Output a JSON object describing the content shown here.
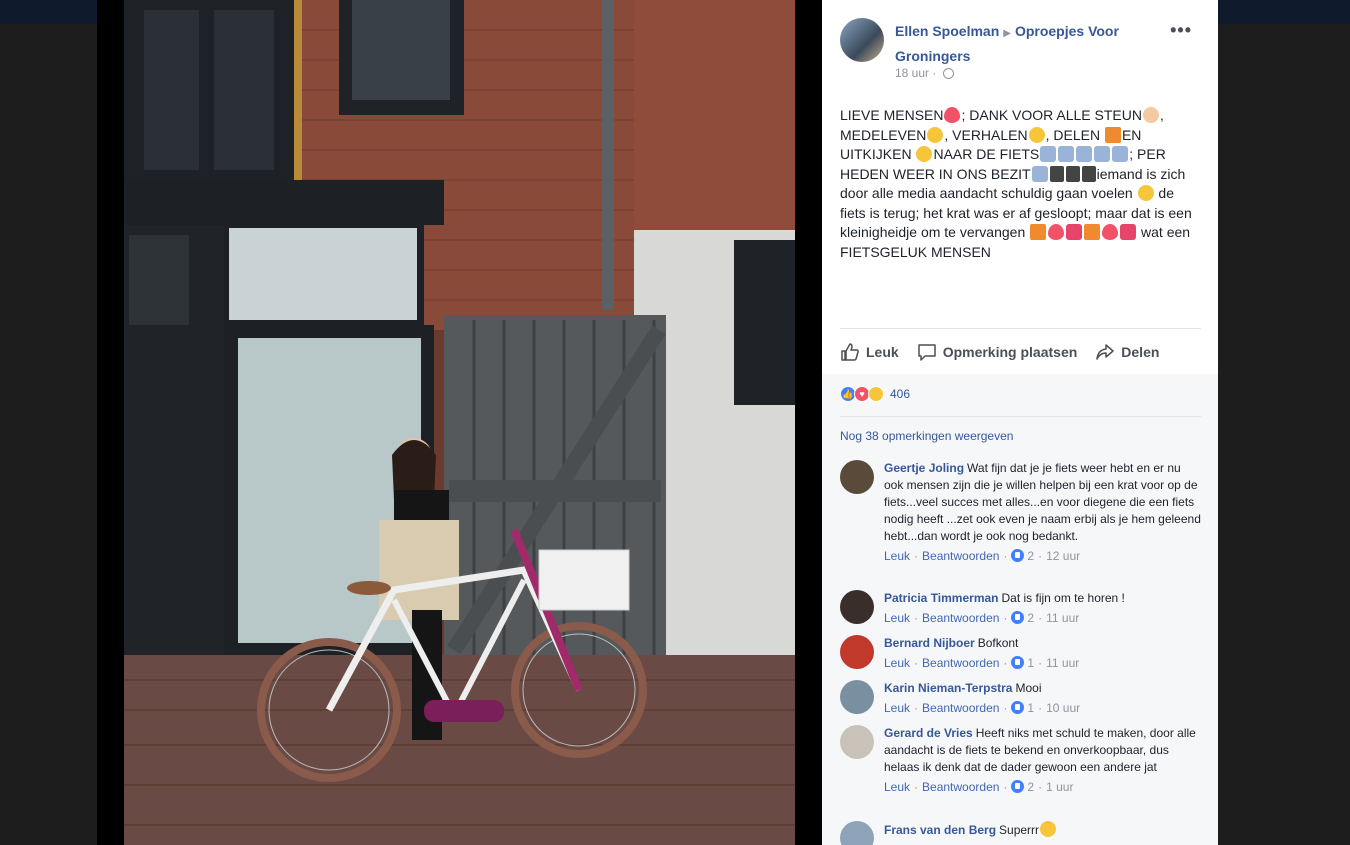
{
  "post": {
    "author": "Ellen Spoelman",
    "group": "Oproepjes Voor Groningers",
    "time": "18 uur",
    "more_label": "•••",
    "text_parts": [
      "LIEVE MENSEN",
      "; DANK VOOR ALLE STEUN",
      ", MEDELEVEN",
      ", VERHALEN",
      ", DELEN ",
      "EN UITKIJKEN ",
      "NAAR DE FIETS",
      "; PER HEDEN WEER IN ONS BEZIT",
      "iemand is zich door alle media aandacht schuldig gaan voelen ",
      " de fiets is terug; het krat was er af gesloopt; maar dat is een kleinigheidje om te vervangen ",
      " wat een FIETSGELUK MENSEN"
    ]
  },
  "actions": {
    "like": "Leuk",
    "comment": "Opmerking plaatsen",
    "share": "Delen"
  },
  "reactions": {
    "count": "406",
    "types": [
      "like-icon",
      "love-icon",
      "haha-icon"
    ]
  },
  "more_comments": "Nog 38 opmerkingen weergeven",
  "comments": [
    {
      "name": "Geertje Joling",
      "text": "Wat fijn dat je je fiets weer hebt en er nu ook mensen zijn die je willen helpen bij een krat voor op de fiets...veel succes met alles...en voor diegene die een fiets nodig heeft ...zet ook even je naam erbij als je hem geleend hebt...dan wordt je ook nog bedankt.",
      "like": "Leuk",
      "reply": "Beantwoorden",
      "likes": "2",
      "time": "12 uur",
      "avatar_color": "#5a4a3a"
    },
    {
      "name": "Patricia Timmerman",
      "text": "Dat is fijn om te horen !",
      "like": "Leuk",
      "reply": "Beantwoorden",
      "likes": "2",
      "time": "11 uur",
      "avatar_color": "#3a2e2a"
    },
    {
      "name": "Bernard Nijboer",
      "text": "Bofkont",
      "like": "Leuk",
      "reply": "Beantwoorden",
      "likes": "1",
      "time": "11 uur",
      "avatar_color": "#c0392b"
    },
    {
      "name": "Karin Nieman-Terpstra",
      "text": "Mooi",
      "like": "Leuk",
      "reply": "Beantwoorden",
      "likes": "1",
      "time": "10 uur",
      "avatar_color": "#7a8fa0"
    },
    {
      "name": "Gerard de Vries",
      "text": "Heeft niks met schuld te maken, door alle aandacht is de fiets te bekend en onverkoopbaar, dus helaas ik denk dat de dader gewoon een andere jat",
      "like": "Leuk",
      "reply": "Beantwoorden",
      "likes": "2",
      "time": "1 uur",
      "avatar_color": "#c9c2b8"
    },
    {
      "name": "Frans van den Berg",
      "text": "Superrr",
      "like": "",
      "reply": "",
      "likes": "",
      "time": "",
      "avatar_color": "#8fa3b8"
    }
  ],
  "colors": {
    "link": "#365899",
    "accent": "#4267b2",
    "muted": "#90949c"
  }
}
